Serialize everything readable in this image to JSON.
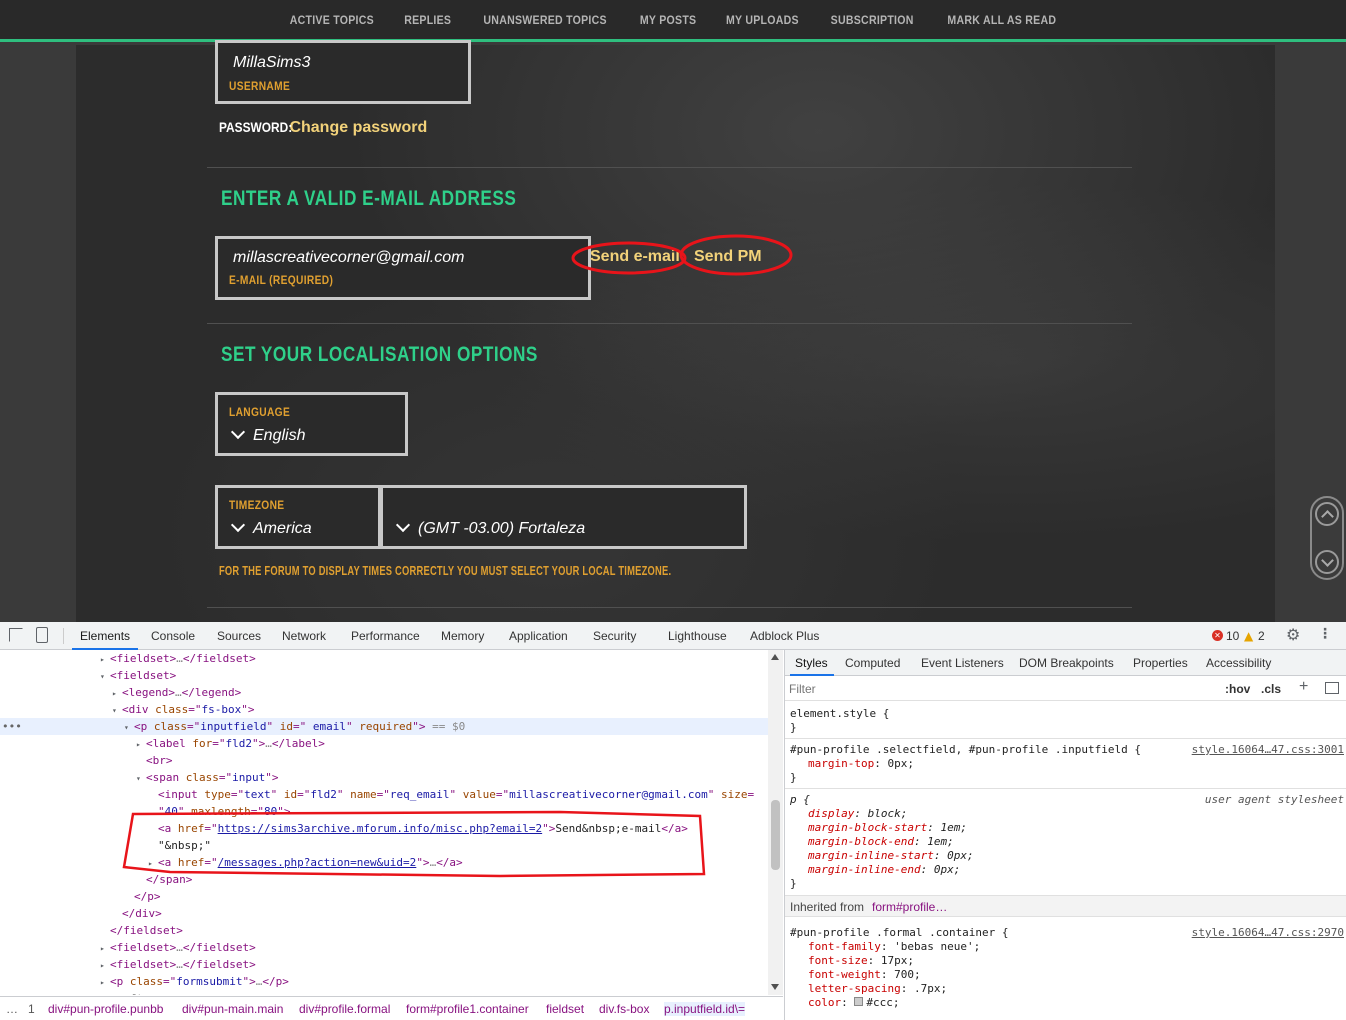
{
  "topnav": [
    "ACTIVE TOPICS",
    "REPLIES",
    "UNANSWERED TOPICS",
    "MY POSTS",
    "MY UPLOADS",
    "SUBSCRIPTION",
    "MARK ALL AS READ"
  ],
  "profile": {
    "username_value": "MillaSims3",
    "username_label": "USERNAME",
    "password_label": "PASSWORD:",
    "password_link": "Change password",
    "email_section_title": "ENTER A VALID E-MAIL ADDRESS",
    "email_value": "millascreativecorner@gmail.com",
    "email_label": "E-MAIL (REQUIRED)",
    "send_email": "Send e-mail",
    "send_pm": "Send PM",
    "locale_section_title": "SET YOUR LOCALISATION OPTIONS",
    "language_label": "LANGUAGE",
    "language_value": "English",
    "timezone_label": "TIMEZONE",
    "timezone_region": "America",
    "timezone_city": "(GMT -03.00) Fortaleza",
    "timezone_hint": "FOR THE FORUM TO DISPLAY TIMES CORRECTLY YOU MUST SELECT YOUR LOCAL TIMEZONE."
  },
  "devtools": {
    "tabs": [
      "Elements",
      "Console",
      "Sources",
      "Network",
      "Performance",
      "Memory",
      "Application",
      "Security",
      "Lighthouse",
      "Adblock Plus"
    ],
    "errors": "10",
    "warnings": "2",
    "dom": [
      {
        "indent": 0,
        "tw": "▸",
        "html": "<span class='t'>&lt;fieldset&gt;</span><span class='g'>…</span><span class='t'>&lt;/fieldset&gt;</span>"
      },
      {
        "indent": 0,
        "tw": "▾",
        "html": "<span class='t'>&lt;fieldset&gt;</span>"
      },
      {
        "indent": 1,
        "tw": "▸",
        "html": "<span class='t'>&lt;legend&gt;</span><span class='g'>…</span><span class='t'>&lt;/legend&gt;</span>"
      },
      {
        "indent": 1,
        "tw": "▾",
        "html": "<span class='t'>&lt;div </span><span class='a'>class</span><span class='t'>=\"</span><span class='v'>fs-box</span><span class='t'>\"&gt;</span>"
      },
      {
        "indent": 2,
        "tw": "▾",
        "html": "<span class='t'>&lt;p </span><span class='a'>class</span><span class='t'>=\"</span><span class='v'>inputfield</span><span class='t'>\" </span><span class='a'>id</span><span class='t'>=\"</span><span class='v'> email</span><span class='t'>\" </span><span class='a'>required</span><span class='t'>\"&gt;</span><span class='g'> == $0</span>",
        "selected": true
      },
      {
        "indent": 3,
        "tw": "▸",
        "html": "<span class='t'>&lt;label </span><span class='a'>for</span><span class='t'>=\"</span><span class='v'>fld2</span><span class='t'>\"&gt;</span><span class='g'>…</span><span class='t'>&lt;/label&gt;</span>"
      },
      {
        "indent": 3,
        "tw": "",
        "html": "<span class='t'>&lt;br&gt;</span>"
      },
      {
        "indent": 3,
        "tw": "▾",
        "html": "<span class='t'>&lt;span </span><span class='a'>class</span><span class='t'>=\"</span><span class='v'>input</span><span class='t'>\"&gt;</span>"
      },
      {
        "indent": 4,
        "tw": "",
        "html": "<span class='t'>&lt;input </span><span class='a'>type</span><span class='t'>=\"</span><span class='v'>text</span><span class='t'>\" </span><span class='a'>id</span><span class='t'>=\"</span><span class='v'>fld2</span><span class='t'>\" </span><span class='a'>name</span><span class='t'>=\"</span><span class='v'>req_email</span><span class='t'>\" </span><span class='a'>value</span><span class='t'>=\"</span><span class='v'>millascreativecorner@gmail.com</span><span class='t'>\" </span><span class='a'>size</span><span class='t'>=</span>"
      },
      {
        "indent": 4,
        "tw": "",
        "html": "<span class='t'>\"</span><span class='v'>40</span><span class='t'>\" </span><span class='a'>maxlength</span><span class='t'>=\"</span><span class='v'>80</span><span class='t'>\"&gt;</span>"
      },
      {
        "indent": 4,
        "tw": "",
        "html": "<span class='t'>&lt;a </span><span class='a'>href</span><span class='t'>=\"</span><span class='u'>https://sims3archive.mforum.info/misc.php?email=2</span><span class='t'>\"&gt;</span><span class='tx'>Send&amp;nbsp;e-mail</span><span class='t'>&lt;/a&gt;</span>"
      },
      {
        "indent": 4,
        "tw": "",
        "html": "<span class='tx'>\"&amp;nbsp;\"</span>"
      },
      {
        "indent": 4,
        "tw": "▸",
        "html": "<span class='t'>&lt;a </span><span class='a'>href</span><span class='t'>=\"</span><span class='u'>/messages.php?action=new&amp;uid=2</span><span class='t'>\"&gt;</span><span class='g'>…</span><span class='t'>&lt;/a&gt;</span>"
      },
      {
        "indent": 3,
        "tw": "",
        "html": "<span class='t'>&lt;/span&gt;</span>"
      },
      {
        "indent": 2,
        "tw": "",
        "html": "<span class='t'>&lt;/p&gt;</span>"
      },
      {
        "indent": 1,
        "tw": "",
        "html": "<span class='t'>&lt;/div&gt;</span>"
      },
      {
        "indent": 0,
        "tw": "",
        "html": "<span class='t'>&lt;/fieldset&gt;</span>"
      },
      {
        "indent": 0,
        "tw": "▸",
        "html": "<span class='t'>&lt;fieldset&gt;</span><span class='g'>…</span><span class='t'>&lt;/fieldset&gt;</span>"
      },
      {
        "indent": 0,
        "tw": "▸",
        "html": "<span class='t'>&lt;fieldset&gt;</span><span class='g'>…</span><span class='t'>&lt;/fieldset&gt;</span>"
      },
      {
        "indent": 0,
        "tw": "▸",
        "html": "<span class='t'>&lt;p </span><span class='a'>class</span><span class='t'>=\"</span><span class='v'>formsubmit</span><span class='t'>\"&gt;</span><span class='g'>…</span><span class='t'>&lt;/p&gt;</span>"
      },
      {
        "indent": 0,
        "tw": "",
        "html": "<span class='g'>::after</span>"
      }
    ],
    "breadcrumb": [
      "…",
      "1",
      "div#pun-profile.punbb",
      "div#pun-main.main",
      "div#profile.formal",
      "form#profile1.container",
      "fieldset",
      "div.fs-box",
      "p.inputfield.id\\="
    ],
    "styles_tabs": [
      "Styles",
      "Computed",
      "Event Listeners",
      "DOM Breakpoints",
      "Properties",
      "Accessibility"
    ],
    "filter_placeholder": "Filter",
    "hov": ":hov",
    "cls": ".cls",
    "element_style": "element.style {",
    "rule1_selector": "#pun-profile .selectfield, #pun-profile .inputfield {",
    "rule1_file": "style.16064…47.css:3001",
    "rule1_prop": "margin-top",
    "rule1_val": "0px;",
    "rule2_selector": "p {",
    "rule2_source": "user agent stylesheet",
    "rule2_props": [
      {
        "p": "display",
        "v": "block;"
      },
      {
        "p": "margin-block-start",
        "v": "1em;"
      },
      {
        "p": "margin-block-end",
        "v": "1em;"
      },
      {
        "p": "margin-inline-start",
        "v": "0px;"
      },
      {
        "p": "margin-inline-end",
        "v": "0px;"
      }
    ],
    "inherited_label": "Inherited from",
    "inherited_from": "form#profile…",
    "rule3_selector": "#pun-profile .formal .container {",
    "rule3_file": "style.16064…47.css:2970",
    "rule3_props": [
      {
        "p": "font-family",
        "v": "'bebas neue';"
      },
      {
        "p": "font-size",
        "v": "17px;"
      },
      {
        "p": "font-weight",
        "v": "700;"
      },
      {
        "p": "letter-spacing",
        "v": ".7px;"
      },
      {
        "p": "color",
        "v": "#ccc;"
      }
    ],
    "close_brace": "}"
  }
}
